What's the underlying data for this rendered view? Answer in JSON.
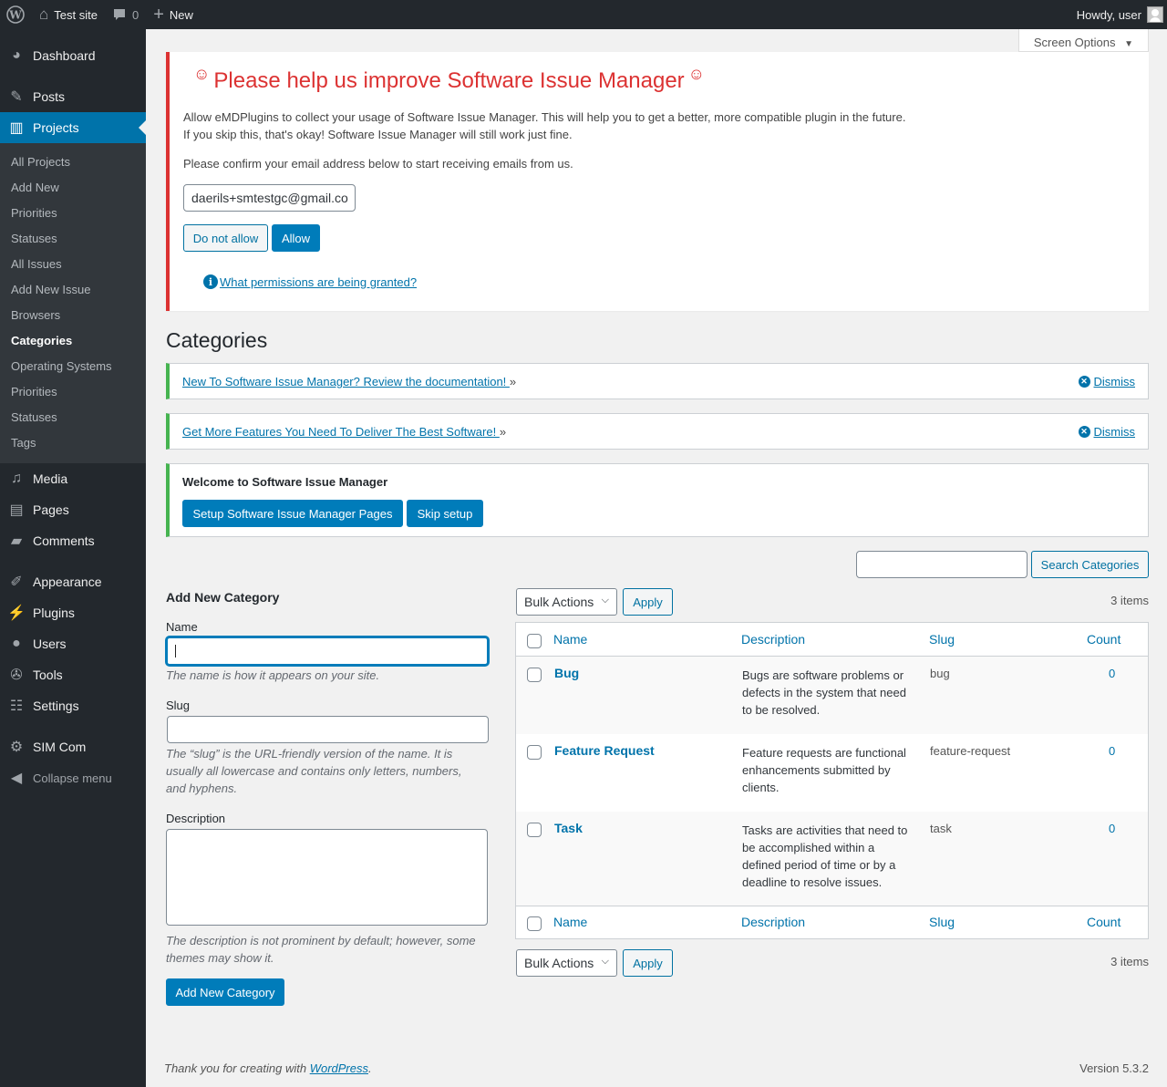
{
  "adminbar": {
    "site_name": "Test site",
    "comments_count": "0",
    "new_label": "New",
    "howdy": "Howdy, user"
  },
  "sidebar": {
    "dashboard": "Dashboard",
    "posts": "Posts",
    "projects": "Projects",
    "projects_sub": [
      "All Projects",
      "Add New",
      "Priorities",
      "Statuses",
      "All Issues",
      "Add New Issue",
      "Browsers",
      "Categories",
      "Operating Systems",
      "Priorities",
      "Statuses",
      "Tags"
    ],
    "media": "Media",
    "pages": "Pages",
    "comments": "Comments",
    "appearance": "Appearance",
    "plugins": "Plugins",
    "users": "Users",
    "tools": "Tools",
    "settings": "Settings",
    "sim_com": "SIM Com",
    "collapse": "Collapse menu"
  },
  "screen_options": "Screen Options",
  "optin": {
    "title": "Please help us improve Software Issue Manager",
    "line1": "Allow eMDPlugins to collect your usage of Software Issue Manager. This will help you to get a better, more compatible plugin in the future.",
    "line2": "If you skip this, that's okay! Software Issue Manager will still work just fine.",
    "line3": "Please confirm your email address below to start receiving emails from us.",
    "email": "daerils+smtestgc@gmail.co",
    "deny_label": "Do not allow",
    "allow_label": "Allow",
    "permissions_link": "What permissions are being granted?"
  },
  "page_title": "Categories",
  "notices": {
    "doc_link": "New To Software Issue Manager? Review the documentation! ",
    "features_link": "Get More Features You Need To Deliver The Best Software! ",
    "raquo": "»",
    "dismiss": "Dismiss",
    "welcome_title": "Welcome to Software Issue Manager",
    "setup_label": "Setup Software Issue Manager Pages",
    "skip_label": "Skip setup"
  },
  "search": {
    "button_label": "Search Categories"
  },
  "form": {
    "title": "Add New Category",
    "name_label": "Name",
    "name_help": "The name is how it appears on your site.",
    "slug_label": "Slug",
    "slug_help_1": "The “slug” is the URL-friendly version of the name. It is",
    "slug_help_2": "usually all lowercase and contains only letters, numbers,",
    "slug_help_3": "and hyphens.",
    "desc_label": "Description",
    "desc_help_1": "The description is not prominent by default; however, some",
    "desc_help_2": "themes may show it.",
    "submit_label": "Add New Category"
  },
  "table": {
    "bulk_actions": "Bulk Actions",
    "apply": "Apply",
    "items": "3 items",
    "columns": [
      "Name",
      "Description",
      "Slug",
      "Count"
    ],
    "rows": [
      {
        "name": "Bug",
        "desc": [
          "Bugs are software problems or",
          "defects in the system that need",
          "to be resolved."
        ],
        "slug": "bug",
        "count": "0"
      },
      {
        "name": "Feature Request",
        "desc": [
          "Feature requests are functional",
          "enhancements submitted by",
          "clients."
        ],
        "slug": "feature-request",
        "count": "0"
      },
      {
        "name": "Task",
        "desc": [
          "Tasks are activities that need to",
          "be accomplished within a",
          "defined period of time or by a",
          "deadline to resolve issues."
        ],
        "slug": "task",
        "count": "0"
      }
    ]
  },
  "footer": {
    "thanks_prefix": "Thank you for creating with ",
    "wordpress": "WordPress",
    "thanks_suffix": ".",
    "version": "Version 5.3.2"
  },
  "colors": {
    "accent": "#0073aa",
    "admin_bar": "#23282d",
    "error": "#dc3232",
    "success": "#46b450"
  }
}
